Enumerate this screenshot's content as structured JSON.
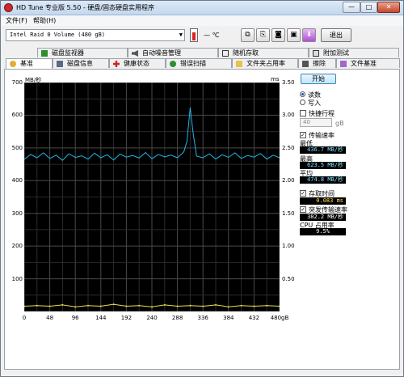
{
  "window": {
    "title": "HD Tune 专业版 5.50 - 硬盘/固态硬盘实用程序",
    "minimize": "—",
    "maximize": "□",
    "close": "✕"
  },
  "menu": [
    "文件(F)",
    "帮助(H)"
  ],
  "toolbar": {
    "drive": "Intel   Raid 0 Volume (480 gB)",
    "temperature": "— ℃",
    "exit": "退出",
    "icons": [
      "copy-icon",
      "copy-info-icon",
      "camera-icon",
      "save-icon",
      "download-icon"
    ]
  },
  "tabs_top": [
    {
      "label": "磁盘监视器",
      "icon": "monitor-icon"
    },
    {
      "label": "自动噪音管理",
      "icon": "speaker-icon"
    },
    {
      "label": "随机存取",
      "icon": "random-access-icon"
    },
    {
      "label": "附加测试",
      "icon": "extra-test-icon"
    }
  ],
  "tabs_bottom": [
    {
      "label": "基准",
      "icon": "benchmark-icon",
      "active": true
    },
    {
      "label": "磁盘信息",
      "icon": "disk-info-icon"
    },
    {
      "label": "健康状态",
      "icon": "health-icon"
    },
    {
      "label": "错误扫描",
      "icon": "error-scan-icon"
    },
    {
      "label": "文件夹占用率",
      "icon": "folder-icon"
    },
    {
      "label": "擦除",
      "icon": "erase-icon"
    },
    {
      "label": "文件基准",
      "icon": "file-benchmark-icon"
    }
  ],
  "controls": {
    "start": "开始",
    "read": "读数",
    "write": "写入",
    "mode_selected": "read",
    "short_stroke": "快捷行程",
    "short_stroke_checked": false,
    "short_stroke_value": "40",
    "short_stroke_unit": "gB",
    "transfer_rate": "传输速率",
    "transfer_rate_checked": true,
    "min_label": "最低",
    "min_value": "436.7 MB/秒",
    "max_label": "最高",
    "max_value": "623.5 MB/秒",
    "avg_label": "平均",
    "avg_value": "474.8 MB/秒",
    "access_time": "存取时间",
    "access_time_checked": true,
    "access_time_value": "0.083 ms",
    "burst_rate": "突发传输速率",
    "burst_rate_checked": true,
    "burst_rate_value": "382.2 MB/秒",
    "cpu_label": "CPU 占用率",
    "cpu_value": "9.5%"
  },
  "chart_data": {
    "type": "line",
    "left_unit": "MB/秒",
    "right_unit": "ms",
    "x_unit": "gB",
    "x_ticks": [
      "0",
      "48",
      "96",
      "144",
      "192",
      "240",
      "288",
      "336",
      "384",
      "432",
      "480gB"
    ],
    "y_ticks_left": [
      "700",
      "600",
      "500",
      "400",
      "300",
      "200",
      "100"
    ],
    "y_ticks_right": [
      "3.50",
      "3.00",
      "2.50",
      "2.00",
      "1.50",
      "1.00",
      "0.50"
    ],
    "xlim": [
      0,
      480
    ],
    "ylim_left": [
      0,
      700
    ],
    "ylim_right": [
      0,
      3.5
    ],
    "grid": true,
    "series": [
      {
        "axis": "left",
        "color": "#1fb7e8",
        "x": [
          0,
          12,
          24,
          36,
          48,
          60,
          72,
          84,
          96,
          108,
          120,
          132,
          144,
          156,
          168,
          180,
          192,
          204,
          216,
          228,
          240,
          252,
          264,
          276,
          288,
          300,
          306,
          312,
          318,
          324,
          336,
          348,
          360,
          372,
          384,
          396,
          408,
          420,
          432,
          444,
          456,
          468,
          480
        ],
        "y": [
          465,
          480,
          470,
          485,
          468,
          478,
          462,
          482,
          471,
          476,
          466,
          484,
          470,
          479,
          463,
          481,
          472,
          477,
          469,
          486,
          467,
          480,
          473,
          478,
          470,
          488,
          520,
          623,
          540,
          475,
          470,
          482,
          466,
          479,
          471,
          485,
          468,
          477,
          472,
          483,
          466,
          478,
          470
        ]
      },
      {
        "axis": "right",
        "color": "#e8e04a",
        "x": [
          0,
          24,
          48,
          72,
          96,
          120,
          144,
          168,
          192,
          216,
          240,
          264,
          288,
          312,
          336,
          360,
          384,
          408,
          432,
          456,
          480
        ],
        "y": [
          0.08,
          0.09,
          0.08,
          0.1,
          0.07,
          0.09,
          0.08,
          0.11,
          0.08,
          0.09,
          0.07,
          0.1,
          0.08,
          0.09,
          0.08,
          0.1,
          0.07,
          0.09,
          0.08,
          0.09,
          0.08
        ]
      }
    ]
  }
}
